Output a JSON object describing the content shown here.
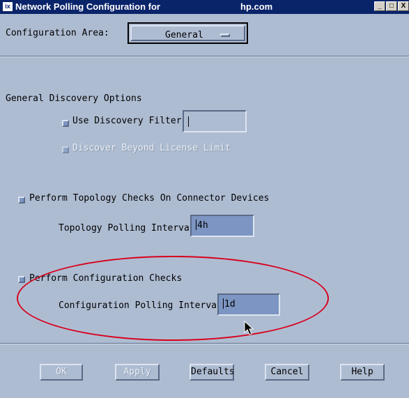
{
  "window": {
    "title": "Network Polling Configuration for",
    "host": "hp.com",
    "icon": "x-icon",
    "minimize_label": "_",
    "maximize_label": "□",
    "close_label": "X"
  },
  "config_area": {
    "label": "Configuration Area:",
    "value": "General"
  },
  "general_discovery": {
    "heading": "General Discovery Options",
    "use_filter": {
      "label": "Use Discovery Filter",
      "checked": false,
      "value": ""
    },
    "beyond_license": {
      "label": "Discover Beyond License Limit",
      "checked": false,
      "disabled": true
    }
  },
  "topology": {
    "check_label": "Perform Topology Checks On Connector Devices",
    "checked": false,
    "interval_label": "Topology Polling Interval",
    "interval_value": "4h"
  },
  "configuration": {
    "check_label": "Perform Configuration Checks",
    "checked": false,
    "interval_label": "Configuration Polling Interval",
    "interval_value": "1d"
  },
  "buttons": {
    "ok": "OK",
    "apply": "Apply",
    "defaults": "Defaults",
    "cancel": "Cancel",
    "help": "Help"
  },
  "colors": {
    "background": "#aebcd2",
    "titlebar": "#0a246a",
    "highlight_ellipse": "#d8001c",
    "field": "#7c95c2"
  }
}
